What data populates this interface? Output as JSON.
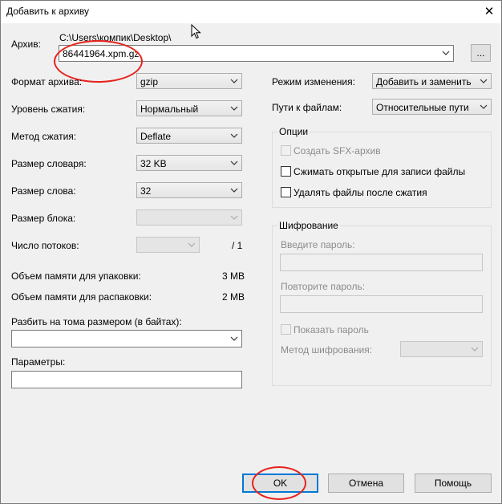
{
  "window": {
    "title": "Добавить к архиву",
    "close_glyph": "✕"
  },
  "archive": {
    "label": "Архив:",
    "path": "C:\\Users\\компик\\Desktop\\",
    "filename": "86441964.xpm.gz",
    "browse_label": "..."
  },
  "left": {
    "format_label": "Формат архива:",
    "format_value": "gzip",
    "level_label": "Уровень сжатия:",
    "level_value": "Нормальный",
    "method_label": "Метод сжатия:",
    "method_value": "Deflate",
    "dict_label": "Размер словаря:",
    "dict_value": "32 KB",
    "word_label": "Размер слова:",
    "word_value": "32",
    "block_label": "Размер блока:",
    "threads_label": "Число потоков:",
    "threads_total": "/ 1",
    "mem_pack_label": "Объем памяти для упаковки:",
    "mem_pack_value": "3 MB",
    "mem_unpack_label": "Объем памяти для распаковки:",
    "mem_unpack_value": "2 MB",
    "split_label": "Разбить на тома размером (в байтах):",
    "params_label": "Параметры:"
  },
  "right": {
    "mode_label": "Режим изменения:",
    "mode_value": "Добавить и заменить",
    "paths_label": "Пути к файлам:",
    "paths_value": "Относительные пути",
    "options_title": "Опции",
    "opt_sfx": "Создать SFX-архив",
    "opt_shared": "Сжимать открытые для записи файлы",
    "opt_delete": "Удалять файлы после сжатия",
    "enc_title": "Шифрование",
    "enc_pwd_label": "Введите пароль:",
    "enc_repeat_label": "Повторите пароль:",
    "enc_show_label": "Показать пароль",
    "enc_method_label": "Метод шифрования:"
  },
  "buttons": {
    "ok": "OK",
    "cancel": "Отмена",
    "help": "Помощь"
  },
  "colors": {
    "annotation": "#e8211c",
    "default_button_border": "#0078d7"
  },
  "icons": [
    "close-icon",
    "chevron-down-icon",
    "mouse-cursor-icon"
  ]
}
